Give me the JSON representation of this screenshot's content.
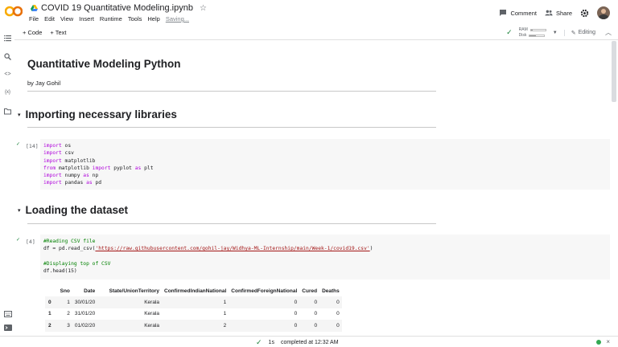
{
  "header": {
    "doc_title": "COVID 19 Quantitative Modeling.ipynb",
    "menu": [
      "File",
      "Edit",
      "View",
      "Insert",
      "Runtime",
      "Tools",
      "Help"
    ],
    "saving": "Saving...",
    "comment_label": "Comment",
    "share_label": "Share"
  },
  "toolbar": {
    "code_label": "+ Code",
    "text_label": "+ Text",
    "ram_label": "RAM",
    "disk_label": "Disk",
    "ram_usage": 0.1,
    "disk_usage": 0.45,
    "editing_label": "Editing"
  },
  "notebook": {
    "title": "Quantitative Modeling Python",
    "author": "by Jay Gohil",
    "section1": "Importing necessary libraries",
    "section2": "Loading the dataset",
    "cell1_count": "[14]",
    "cell2_count": "[4]",
    "cell1_lines": [
      {
        "kw": "import",
        "rest": " os"
      },
      {
        "kw": "import",
        "rest": " csv"
      },
      {
        "kw": "import",
        "rest": " matplotlib"
      },
      {
        "kw": "from",
        "rest": " matplotlib ",
        "kw2": "import",
        "rest2": " pyplot ",
        "kw3": "as",
        "rest3": " plt"
      },
      {
        "kw": "import",
        "rest": " numpy ",
        "kw2": "as",
        "rest2": " np"
      },
      {
        "kw": "import",
        "rest": " pandas ",
        "kw2": "as",
        "rest2": " pd"
      }
    ],
    "cell2": {
      "comment1": "#Reading CSV file",
      "read_prefix": "df = pd.read_csv(",
      "url": "'https://raw.githubusercontent.com/gohil-jay/Widhya-ML-Internship/main/Week-1/covid19.csv'",
      "read_suffix": ")",
      "comment2": "#Displaying top of CSV",
      "head": "df.head(15)"
    }
  },
  "table": {
    "columns": [
      "",
      "Sno",
      "Date",
      "State/UnionTerritory",
      "ConfirmedIndianNational",
      "ConfirmedForeignNational",
      "Cured",
      "Deaths"
    ],
    "rows": [
      [
        "0",
        "1",
        "30/01/20",
        "Kerala",
        "1",
        "0",
        "0",
        "0"
      ],
      [
        "1",
        "2",
        "31/01/20",
        "Kerala",
        "1",
        "0",
        "0",
        "0"
      ],
      [
        "2",
        "3",
        "01/02/20",
        "Kerala",
        "2",
        "0",
        "0",
        "0"
      ]
    ]
  },
  "status": {
    "duration": "1s",
    "message": "completed at 12:32 AM"
  },
  "colors": {
    "accent_orange": "#f9ab00",
    "success_green": "#188038",
    "keyword_purple": "#af00db",
    "string_red": "#a31515",
    "comment_green": "#008000"
  }
}
